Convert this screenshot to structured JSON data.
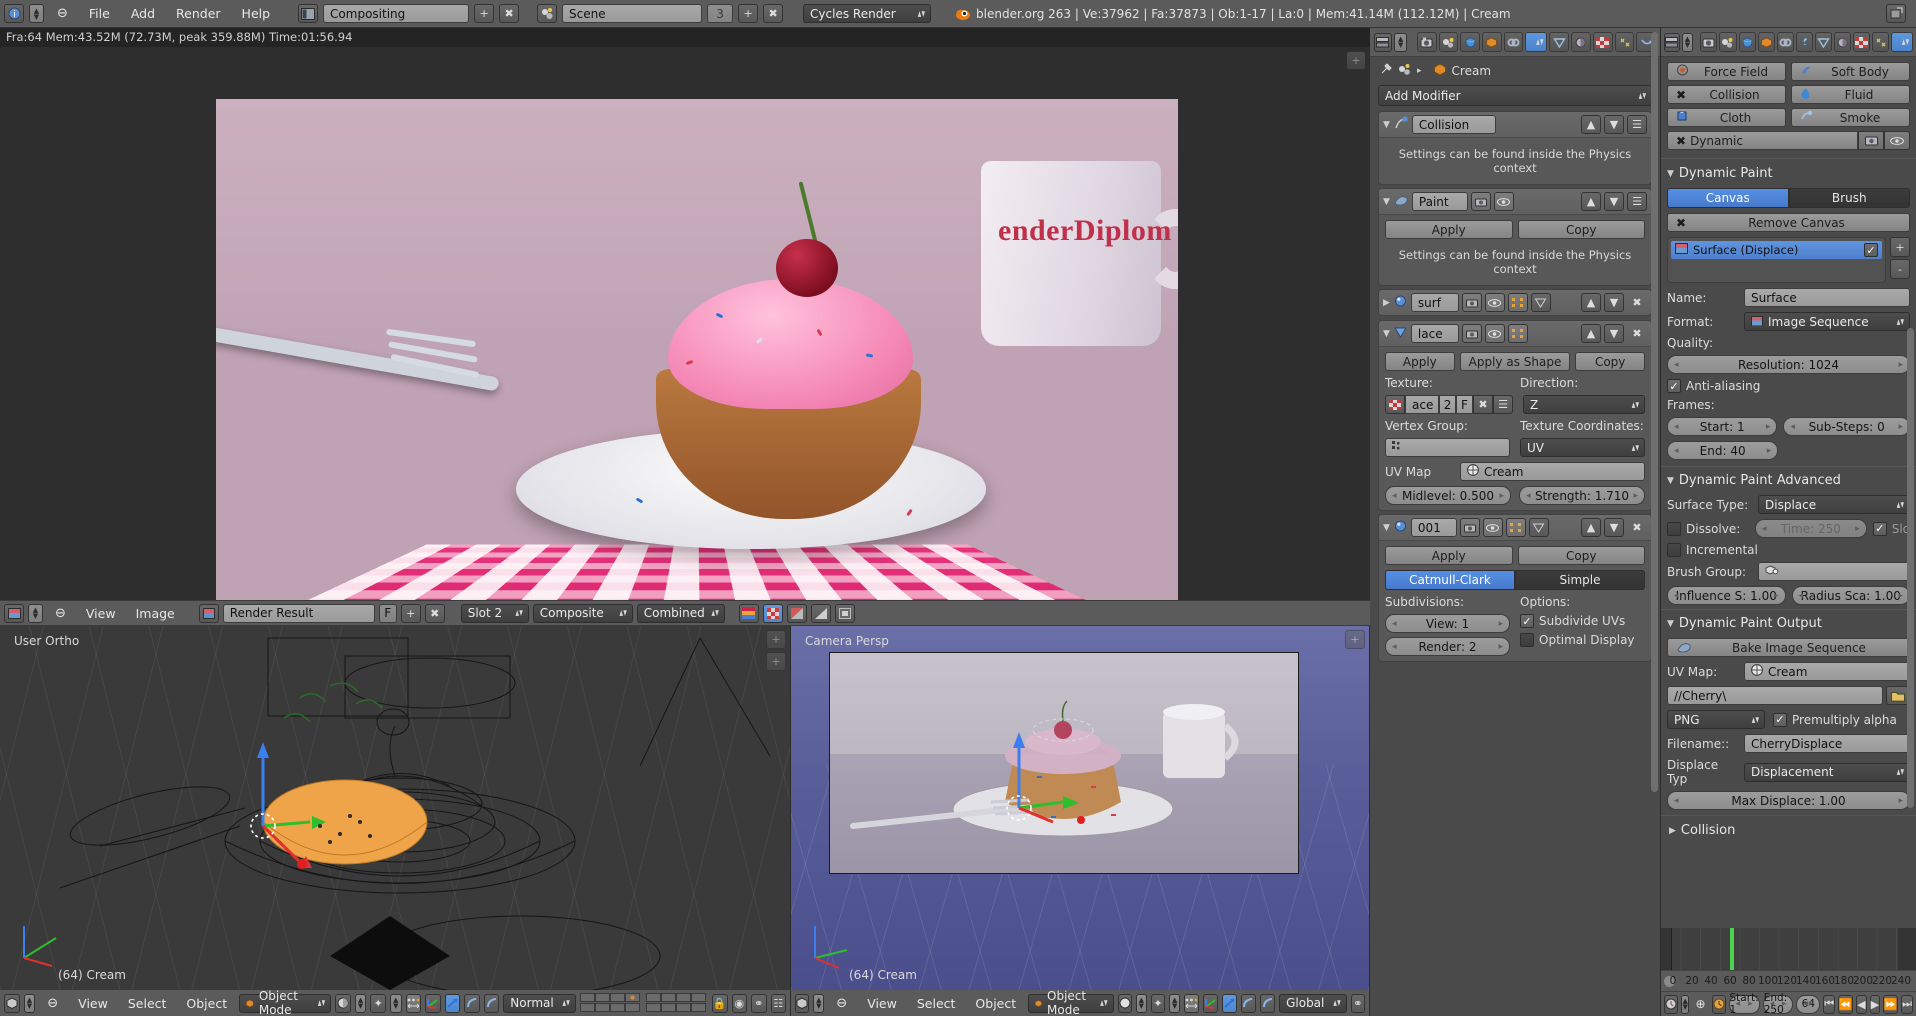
{
  "topbar": {
    "editor_icon": "info-editor-icon",
    "menus": [
      "File",
      "Add",
      "Render",
      "Help"
    ],
    "screen_layout": {
      "icon": "screen-layout-icon",
      "value": "Compositing",
      "add": "+",
      "remove": "x"
    },
    "scene": {
      "icon": "scene-icon",
      "value": "Scene",
      "users": "3",
      "add": "+",
      "remove": "x"
    },
    "engine": "Cycles Render",
    "stats": "blender.org 263 | Ve:37962 | Fa:37873 | Ob:1-17 | La:0 | Mem:41.14M (112.12M) | Cream",
    "blender_icon": "blender-logo-icon",
    "maximize_icon": "maximize-icon"
  },
  "render_info": "Fra:64 Mem:43.52M (72.73M, peak 359.88M) Time:01:56.94",
  "image_editor": {
    "editor_icon": "image-editor-icon",
    "menus": [
      "View",
      "Image"
    ],
    "image_icon": "image-datablock-icon",
    "image_name": "Render Result",
    "fake_user": "F",
    "add": "+",
    "remove": "x",
    "slot": "Slot 2",
    "layer": "Composite",
    "pass": "Combined",
    "display_icons": [
      "color-swatch-icon",
      "rgb-channel-icon",
      "alpha-channel-icon",
      "zdepth-icon",
      "render-region-icon"
    ]
  },
  "render_image": {
    "mug_text": "enderDiplom"
  },
  "viewport_left": {
    "view_label": "User Ortho",
    "object_label": "(64) Cream",
    "header": {
      "editor_icon": "view3d-editor-icon",
      "menus": [
        "View",
        "Select",
        "Object"
      ],
      "mode": "Object Mode",
      "shading": "solid-shading-icon",
      "pivot": "pivot-median-icon",
      "manipulator_icons": [
        "translate-manip-icon",
        "rotate-manip-icon",
        "scale-manip-icon"
      ],
      "orientation": "Normal",
      "layers_icon": "scene-layers-icon",
      "lock_icon": "lock-layers-icon",
      "proportional_icon": "proportional-edit-icon",
      "snap_icon": "snap-magnet-icon"
    }
  },
  "viewport_right": {
    "view_label": "Camera Persp",
    "object_label": "(64) Cream",
    "header": {
      "editor_icon": "view3d-editor-icon",
      "menus": [
        "View",
        "Select",
        "Object"
      ],
      "mode": "Object Mode",
      "shading": "solid-shading-icon",
      "pivot": "pivot-median-icon",
      "manipulator_icons": [
        "translate-manip-icon",
        "rotate-manip-icon",
        "scale-manip-icon"
      ],
      "orientation": "Global"
    }
  },
  "properties_modifiers": {
    "context_tabs": [
      "render-tab-icon",
      "scene-tab-icon",
      "world-tab-icon",
      "object-tab-icon",
      "constraint-tab-icon",
      "modifier-tab-icon",
      "data-tab-icon",
      "material-tab-icon",
      "texture-tab-icon",
      "particles-tab-icon",
      "physics-tab-icon"
    ],
    "selected_tab": "modifier-tab-icon",
    "breadcrumb": {
      "pin_icon": "pin-icon",
      "scene_icon": "scene-icon",
      "arrow": "▸",
      "object_icon": "object-icon",
      "object": "Cream"
    },
    "add_modifier": "Add Modifier",
    "modifiers": [
      {
        "name": "Collision",
        "icon": "collision-modifier-icon",
        "expanded": true,
        "note": "Settings can be found inside the Physics context",
        "buttons": []
      },
      {
        "name": "Paint",
        "icon": "dynamic-paint-modifier-icon",
        "expanded": true,
        "note": "Settings can be found inside the Physics context",
        "buttons": [
          "Apply",
          "Copy"
        ]
      },
      {
        "name": "surf",
        "icon": "smooth-modifier-icon",
        "expanded": false
      },
      {
        "name": "lace",
        "icon": "displace-modifier-icon",
        "expanded": true,
        "buttons": [
          "Apply",
          "Apply as Shape",
          "Copy"
        ],
        "texture_label": "Texture:",
        "texture_name": "ace",
        "texture_users": "2",
        "texture_fake_user": "F",
        "direction_label": "Direction:",
        "direction": "Z",
        "vertex_group_label": "Vertex Group:",
        "vertex_group": "",
        "texture_coords_label": "Texture Coordinates:",
        "texture_coords": "UV",
        "uv_map_label": "UV Map",
        "uv_map": "Cream",
        "midlevel": "Midlevel: 0.500",
        "strength": "Strength: 1.710"
      },
      {
        "name": "001",
        "icon": "subsurf-modifier-icon",
        "expanded": true,
        "buttons": [
          "Apply",
          "Copy"
        ],
        "subdiv_type": [
          "Catmull-Clark",
          "Simple"
        ],
        "subdiv_active": "Catmull-Clark",
        "subdivisions_label": "Subdivisions:",
        "view": "View: 1",
        "render": "Render: 2",
        "options_label": "Options:",
        "subdivide_uvs": "Subdivide UVs",
        "subdivide_uvs_checked": true,
        "optimal_display": "Optimal Display",
        "optimal_display_checked": false
      }
    ]
  },
  "properties_physics": {
    "context_tabs": [
      "render-tab-icon",
      "scene-tab-icon",
      "world-tab-icon",
      "object-tab-icon",
      "constraint-tab-icon",
      "modifier-tab-icon",
      "data-tab-icon",
      "material-tab-icon",
      "texture-tab-icon",
      "particles-tab-icon",
      "physics-tab-icon"
    ],
    "selected_tab": "physics-tab-icon",
    "physics_buttons": [
      {
        "label": "Force Field",
        "icon": "force-field-icon"
      },
      {
        "label": "Soft Body",
        "icon": "soft-body-icon"
      },
      {
        "label": "Collision",
        "icon": "collision-icon"
      },
      {
        "label": "Fluid",
        "icon": "fluid-icon"
      },
      {
        "label": "Cloth",
        "icon": "cloth-icon"
      },
      {
        "label": "Smoke",
        "icon": "smoke-icon"
      },
      {
        "label": "Dynamic",
        "icon": "dynamic-paint-icon"
      }
    ],
    "dynamic_paint": {
      "title": "Dynamic Paint",
      "type_tabs": [
        "Canvas",
        "Brush"
      ],
      "type_active": "Canvas",
      "remove_button": "Remove Canvas",
      "surface_list": [
        {
          "label": "Surface (Displace)",
          "icon": "image-sequence-icon",
          "enabled": true
        }
      ],
      "add_icon": "+",
      "remove_icon": "-",
      "name_label": "Name:",
      "name_value": "Surface",
      "format_label": "Format:",
      "format_value": "Image Sequence",
      "quality_label": "Quality:",
      "resolution": "Resolution: 1024",
      "antialiasing": "Anti-aliasing",
      "antialiasing_checked": true,
      "frames_label": "Frames:",
      "start": "Start: 1",
      "substeps": "Sub-Steps: 0",
      "end": "End: 40"
    },
    "dynamic_paint_advanced": {
      "title": "Dynamic Paint Advanced",
      "surface_type_label": "Surface Type:",
      "surface_type": "Displace",
      "dissolve_label": "Dissolve:",
      "dissolve_checked": false,
      "dissolve_time": "Time: 250",
      "slow_label": "Slo",
      "slow_checked": true,
      "incremental_label": "Incremental",
      "incremental_checked": false,
      "brush_group_label": "Brush Group:",
      "brush_group": "",
      "influence": "Influence S: 1.00",
      "radius": "Radius Sca: 1.00"
    },
    "dynamic_paint_output": {
      "title": "Dynamic Paint Output",
      "bake_button": "Bake Image Sequence",
      "bake_icon": "bake-icon",
      "uv_map_label": "UV Map:",
      "uv_map": "Cream",
      "path": "//Cherry\\",
      "folder_icon": "folder-icon",
      "file_format": "PNG",
      "premultiply": "Premultiply alpha",
      "premultiply_checked": true,
      "filename_label": "Filename::",
      "filename": "CherryDisplace",
      "displace_type_label": "Displace Typ",
      "displace_type": "Displacement",
      "max_displace": "Max Displace: 1.00"
    },
    "collision_panel": "Collision"
  },
  "timeline": {
    "editor_icon": "timeline-editor-icon",
    "record_icon": "record-icon",
    "sync_icon": "sync-icon",
    "start": "Start: 1",
    "end": "End: 250",
    "current_frame": "64",
    "playback_icons": [
      "jump-start-icon",
      "prev-keyframe-icon",
      "play-reverse-icon",
      "play-icon",
      "next-keyframe-icon",
      "jump-end-icon"
    ],
    "ruler_ticks": [
      "0",
      "20",
      "40",
      "60",
      "80",
      "100",
      "120",
      "140",
      "160",
      "180",
      "200",
      "220",
      "240"
    ],
    "playhead_frame": 64
  }
}
